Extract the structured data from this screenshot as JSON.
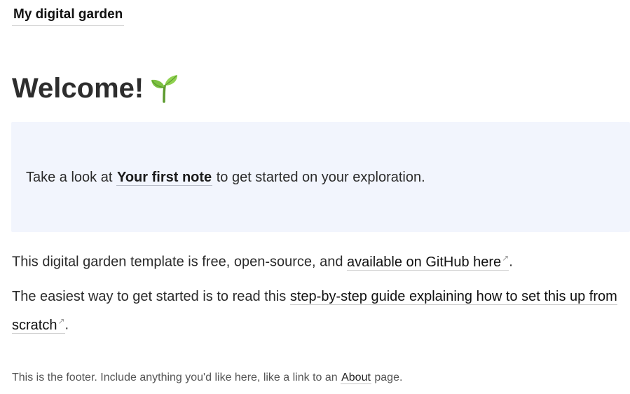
{
  "header": {
    "site_title": "My digital garden"
  },
  "main": {
    "title": "Welcome!",
    "title_icon": "seedling-icon",
    "callout": {
      "prefix": "Take a look at ",
      "link_label": "Your first note",
      "suffix": " to get started on your exploration."
    },
    "paragraph1": {
      "prefix": "This digital garden template is free, open-source, and ",
      "link_label": "available on GitHub here",
      "suffix": "."
    },
    "paragraph2": {
      "prefix": "The easiest way to get started is to read this ",
      "link_label": "step-by-step guide explaining how to set this up from scratch",
      "suffix": "."
    },
    "external_link_icon": "↗"
  },
  "footer": {
    "prefix": "This is the footer. Include anything you'd like here, like a link to an ",
    "link_label": "About",
    "suffix": " page."
  },
  "colors": {
    "callout_background": "#f2f5fd",
    "text": "#2b2b2b",
    "link_underline": "#cfcfcf"
  }
}
